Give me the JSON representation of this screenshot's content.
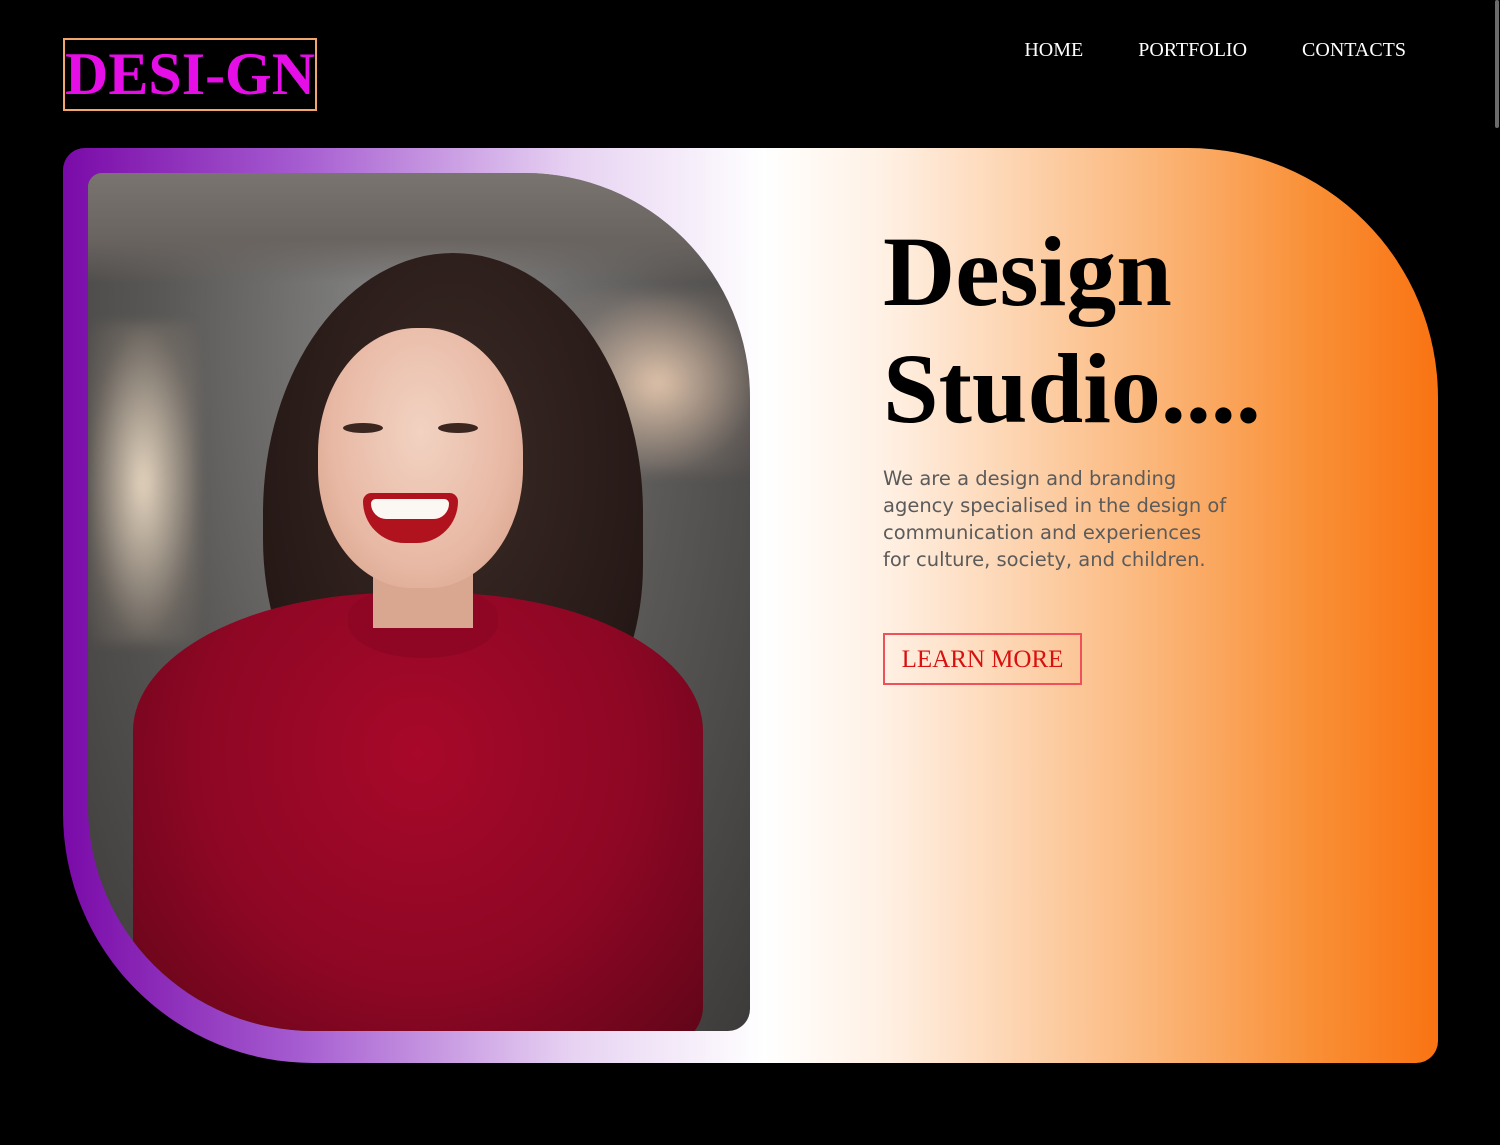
{
  "header": {
    "logo_text": "DESI-GN",
    "nav": [
      {
        "label": "HOME"
      },
      {
        "label": "PORTFOLIO"
      },
      {
        "label": "CONTACTS"
      }
    ]
  },
  "hero": {
    "headline_line1": "Design",
    "headline_line2": "Studio....",
    "description": "We are a design and branding agency specialised in the design of communication and experiences for culture, society, and children.",
    "cta_label": "LEARN MORE",
    "photo_alt": "Smiling woman in a red sweater"
  },
  "colors": {
    "logo": "#e60ee6",
    "logo_border": "#f2a66b",
    "gradient_start": "#7a0aa8",
    "gradient_mid": "#ffffff",
    "gradient_end": "#f97312",
    "cta_text": "#d8100f",
    "cta_border": "#f0505c",
    "page_background": "#000000"
  }
}
